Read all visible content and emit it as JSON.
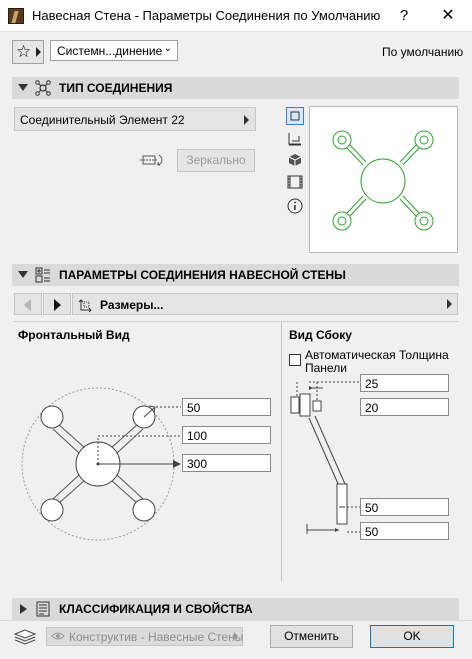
{
  "window": {
    "title": "Навесная Стена - Параметры Соединения по Умолчанию",
    "help": "?",
    "close": "✕"
  },
  "toolbar": {
    "favorites_icon": "star-icon",
    "preset": "Системн...динение",
    "default_label": "По умолчанию"
  },
  "section_type": {
    "label": "ТИП СОЕДИНЕНИЯ",
    "element": "Соединительный Элемент 22",
    "mirror_button": "Зеркально",
    "view_tools": [
      "plan-icon",
      "section-view-icon",
      "3d-cube-icon",
      "film-icon",
      "info-icon"
    ]
  },
  "section_params": {
    "label": "ПАРАМЕТРЫ СОЕДИНЕНИЯ НАВЕСНОЙ СТЕНЫ",
    "page": "Размеры...",
    "front": {
      "heading": "Фронтальный Вид",
      "fields": [
        "50",
        "100",
        "300"
      ]
    },
    "side": {
      "heading": "Вид Сбоку",
      "auto_thickness_label": "Автоматическая Толщина Панели",
      "auto_thickness_checked": false,
      "fields_top": [
        "25",
        "20"
      ],
      "fields_bottom": [
        "50",
        "50"
      ]
    }
  },
  "section_class": {
    "label": "КЛАССИФИКАЦИЯ И СВОЙСТВА"
  },
  "footer": {
    "layer": "Конструктив - Навесные Стены",
    "cancel": "Отменить",
    "ok": "OK"
  },
  "colors": {
    "preview_stroke": "#2aa52a",
    "ok_border": "#0078d7",
    "section_bar": "#dadada"
  }
}
